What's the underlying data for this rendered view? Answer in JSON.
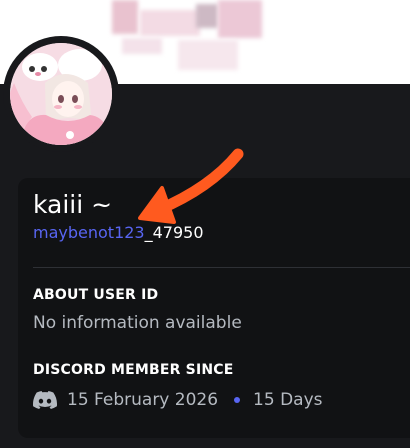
{
  "profile": {
    "display_name": "kaiii ~",
    "username_link": "maybenot123",
    "username_rest": "_47950"
  },
  "sections": {
    "about": {
      "label": "ABOUT USER ID",
      "text": "No information available"
    },
    "member_since": {
      "label": "DISCORD MEMBER SINCE",
      "date": "15 February 2026",
      "duration": "15 Days"
    }
  },
  "icons": {
    "discord": "discord-icon",
    "avatar": "avatar",
    "annotation_arrow": "arrow-icon"
  },
  "colors": {
    "accent": "#5865f2",
    "annotation": "#ff5a1f",
    "background": "#18191c",
    "card": "#111214"
  }
}
